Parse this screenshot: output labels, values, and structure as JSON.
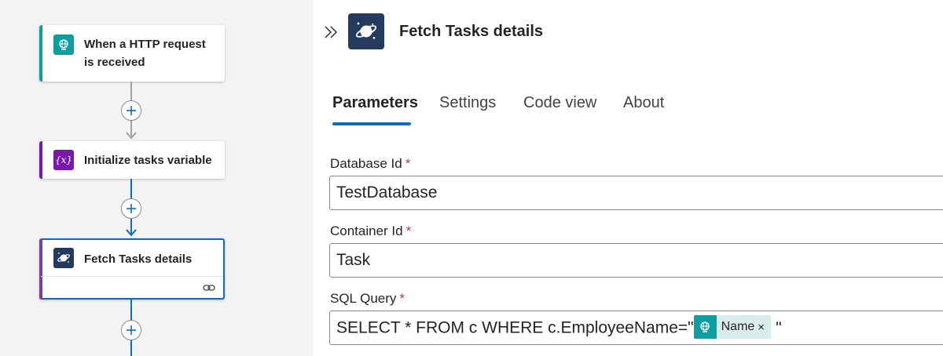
{
  "flow": {
    "steps": [
      {
        "title_line1": "When a HTTP request",
        "title_line2": "is received",
        "icon": "http-request-globe-icon",
        "accent": "#0f9ea0"
      },
      {
        "title": "Initialize tasks variable",
        "icon": "variable-icon",
        "accent": "#7719aa"
      },
      {
        "title": "Fetch Tasks details",
        "icon": "cosmos-db-planet-icon",
        "accent": "#7e3f98",
        "selected": true,
        "footer_icon": "link-icon"
      }
    ],
    "connector_colors": {
      "gray": "#a0a0a0",
      "blue": "#0f6cbd"
    }
  },
  "panel": {
    "collapse_icon": "double-chevron-right-icon",
    "title": "Fetch Tasks details",
    "tabs": [
      {
        "label": "Parameters",
        "active": true
      },
      {
        "label": "Settings"
      },
      {
        "label": "Code view"
      },
      {
        "label": "About"
      }
    ],
    "fields": {
      "database_id": {
        "label": "Database Id",
        "required_mark": "*",
        "value": "TestDatabase"
      },
      "container_id": {
        "label": "Container Id",
        "required_mark": "*",
        "value": "Task"
      },
      "sql_query": {
        "label": "SQL Query",
        "required_mark": "*",
        "value_prefix": "SELECT * FROM c WHERE c.EmployeeName=\"",
        "token": {
          "name": "Name",
          "remove": "×",
          "icon": "http-request-globe-icon"
        },
        "value_suffix": "\""
      }
    }
  },
  "colors": {
    "accent_blue": "#0f6cbd",
    "required_red": "#c4314b"
  }
}
